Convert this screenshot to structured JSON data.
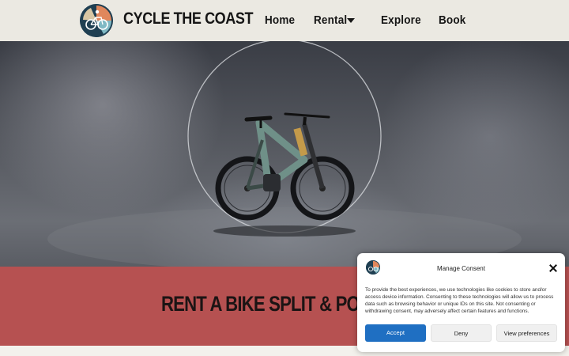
{
  "header": {
    "brand": "CYCLE THE COAST",
    "nav": {
      "home": "Home",
      "rental": "Rental",
      "explore": "Explore",
      "book": "Book"
    }
  },
  "hero": {
    "image": "electric-mountain-bike-photo"
  },
  "band": {
    "title": "RENT A BIKE SPLIT & PODS"
  },
  "consent": {
    "title": "Manage Consent",
    "body": "To provide the best experiences, we use technologies like cookies to store and/or access device information. Consenting to these technologies will allow us to process data such as browsing behavior or unique IDs on this site. Not consenting or withdrawing consent, may adversely affect certain features and functions.",
    "buttons": {
      "accept": "Accept",
      "deny": "Deny",
      "preferences": "View preferences"
    }
  },
  "colors": {
    "header_bg": "#ebe9e2",
    "band_bg": "#b65151",
    "accept_bg": "#1f6fc2"
  }
}
